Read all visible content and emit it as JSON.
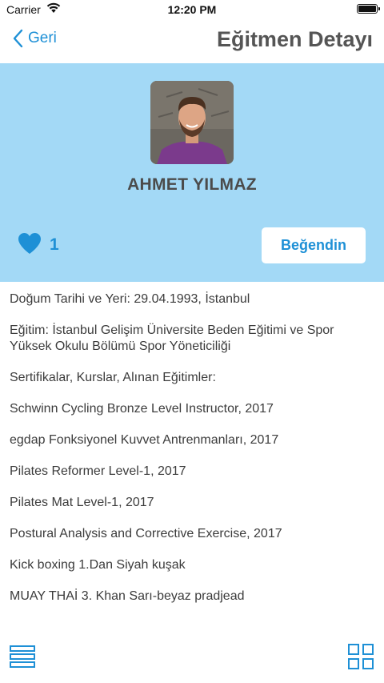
{
  "status_bar": {
    "carrier": "Carrier",
    "time": "12:20 PM",
    "icons": [
      "wifi-icon",
      "battery-icon"
    ]
  },
  "nav": {
    "back_label": "Geri",
    "title": "Eğitmen Detayı"
  },
  "profile": {
    "name": "AHMET YILMAZ",
    "like_count": "1",
    "like_button": "Beğendin"
  },
  "details": [
    "Doğum Tarihi ve Yeri: 29.04.1993, İstanbul",
    "Eğitim: İstanbul Gelişim Üniversite Beden Eğitimi ve Spor Yüksek Okulu Bölümü Spor Yöneticiliği",
    "Sertifikalar, Kurslar, Alınan Eğitimler:",
    "Schwinn Cycling Bronze Level Instructor, 2017",
    "egdap Fonksiyonel Kuvvet Antrenmanları, 2017",
    "Pilates Reformer Level-1, 2017",
    "Pilates Mat Level-1, 2017",
    "Postural Analysis and Corrective Exercise, 2017",
    "Kick boxing 1.Dan Siyah kuşak",
    "MUAY THAİ 3. Khan Sarı-beyaz pradjead"
  ],
  "toolbar": {
    "icons": [
      "list-view-icon",
      "grid-view-icon"
    ]
  },
  "colors": {
    "accent": "#1e90d6",
    "header_bg": "#a3d9f6",
    "heart": "#1e90d6"
  }
}
